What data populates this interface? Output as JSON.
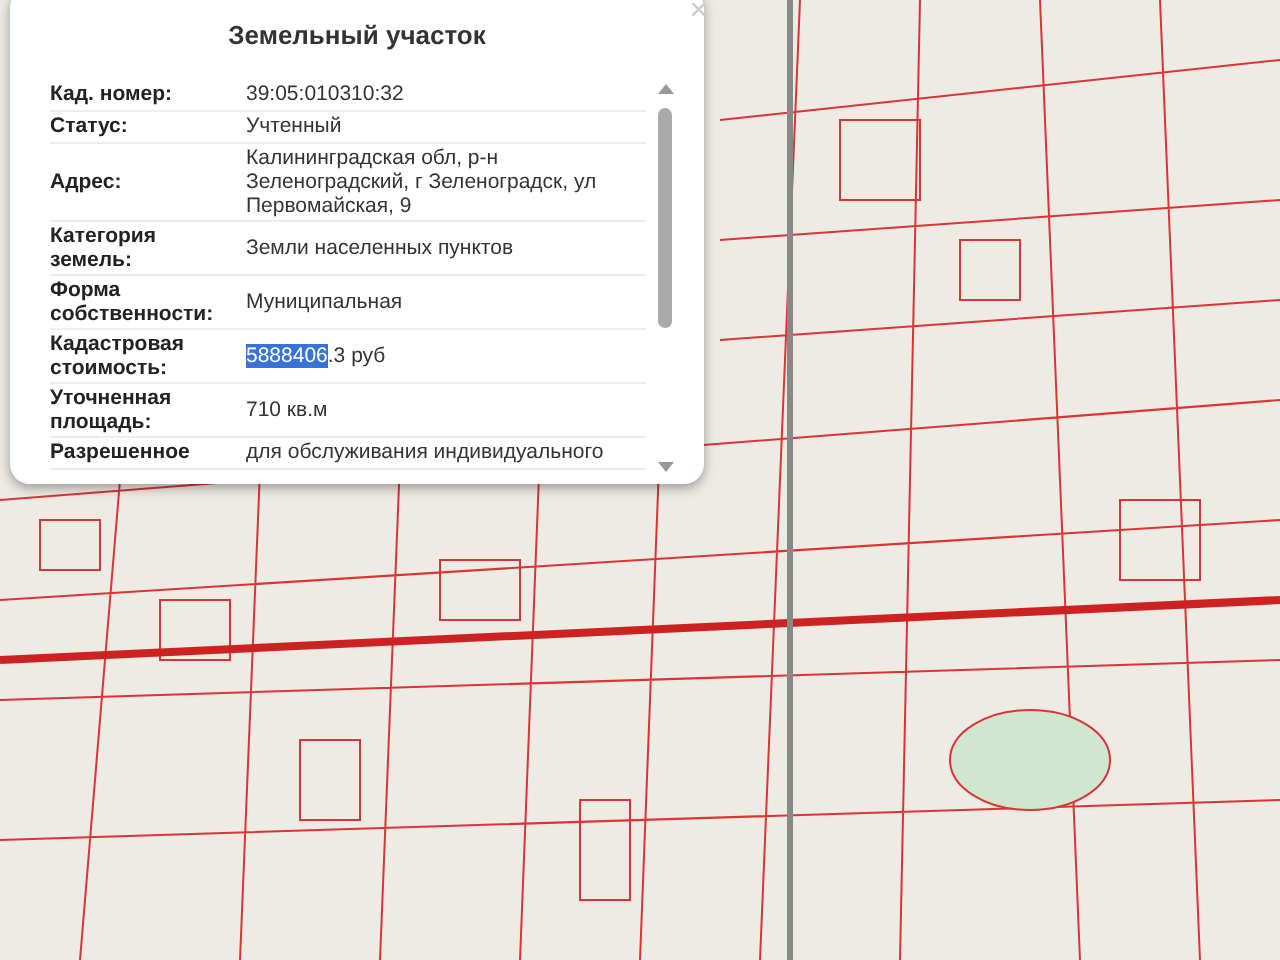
{
  "popup": {
    "title": "Земельный участок",
    "close": "×",
    "rows": [
      {
        "label": "Кад. номер:",
        "value": [
          {
            "text": "39:05:010310:32",
            "selected": false
          }
        ]
      },
      {
        "label": "Статус:",
        "value": [
          {
            "text": "Учтенный",
            "selected": false
          }
        ]
      },
      {
        "label": "Адрес:",
        "value": [
          {
            "text": "Калининградская обл, р-н Зеленоградский, г Зеленоградск, ул Первомайская, 9",
            "selected": false
          }
        ]
      },
      {
        "label": "Категория земель:",
        "value": [
          {
            "text": "Земли населенных пунктов",
            "selected": false
          }
        ]
      },
      {
        "label": "Форма собственности:",
        "value": [
          {
            "text": "Муниципальная",
            "selected": false
          }
        ]
      },
      {
        "label": "Кадастровая стоимость:",
        "value": [
          {
            "text": "5888406",
            "selected": true
          },
          {
            "text": ".3 руб",
            "selected": false
          }
        ]
      },
      {
        "label": "Уточненная площадь:",
        "value": [
          {
            "text": "710 кв.м",
            "selected": false
          }
        ]
      },
      {
        "label": "Разрешенное",
        "value": [
          {
            "text": "для обслуживания индивидуального",
            "selected": false
          }
        ]
      }
    ]
  }
}
